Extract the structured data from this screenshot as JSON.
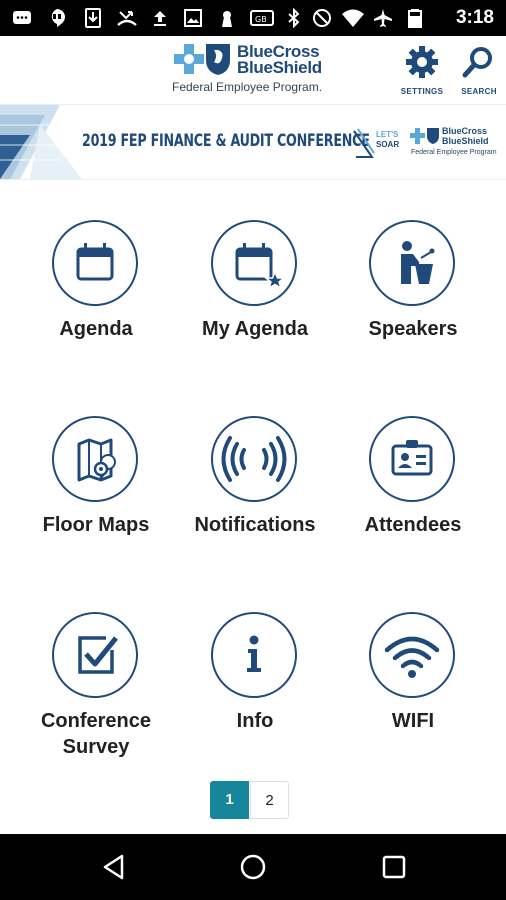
{
  "status_bar": {
    "time": "3:18",
    "icons": [
      "messaging-icon",
      "hangouts-icon",
      "download-icon",
      "phone-missed-icon",
      "upload-icon",
      "image-icon",
      "keyhole-icon",
      "sim-icon",
      "bluetooth-icon",
      "do-not-disturb-icon",
      "wifi-icon",
      "airplane-icon",
      "battery-icon"
    ]
  },
  "header": {
    "logo_line1": "BlueCross",
    "logo_line2": "BlueShield",
    "logo_sub": "Federal Employee Program.",
    "settings_label": "SETTINGS",
    "search_label": "SEARCH"
  },
  "banner": {
    "title": "2019 FEP FINANCE & AUDIT CONFERENCE",
    "soar_line1": "LET'S",
    "soar_line2": "SOAR",
    "logo_line1": "BlueCross",
    "logo_line2": "BlueShield",
    "logo_sub": "Federal Employee Program"
  },
  "tiles": [
    {
      "label": "Agenda",
      "icon": "calendar-icon"
    },
    {
      "label": "My Agenda",
      "icon": "calendar-star-icon"
    },
    {
      "label": "Speakers",
      "icon": "speaker-podium-icon"
    },
    {
      "label": "Floor Maps",
      "icon": "map-icon"
    },
    {
      "label": "Notifications",
      "icon": "broadcast-icon"
    },
    {
      "label": "Attendees",
      "icon": "id-badge-icon"
    },
    {
      "label_line1": "Conference",
      "label_line2": "Survey",
      "icon": "checkbox-icon"
    },
    {
      "label": "Info",
      "icon": "info-icon"
    },
    {
      "label": "WIFI",
      "icon": "wifi-icon"
    }
  ],
  "pagination": {
    "pages": [
      "1",
      "2"
    ],
    "current": "1"
  },
  "colors": {
    "brand_blue": "#1f4a7a",
    "accent_teal": "#16869c",
    "light_blue": "#5aa7d9"
  },
  "nav": {
    "icons": [
      "back-icon",
      "home-icon",
      "recents-icon"
    ]
  }
}
